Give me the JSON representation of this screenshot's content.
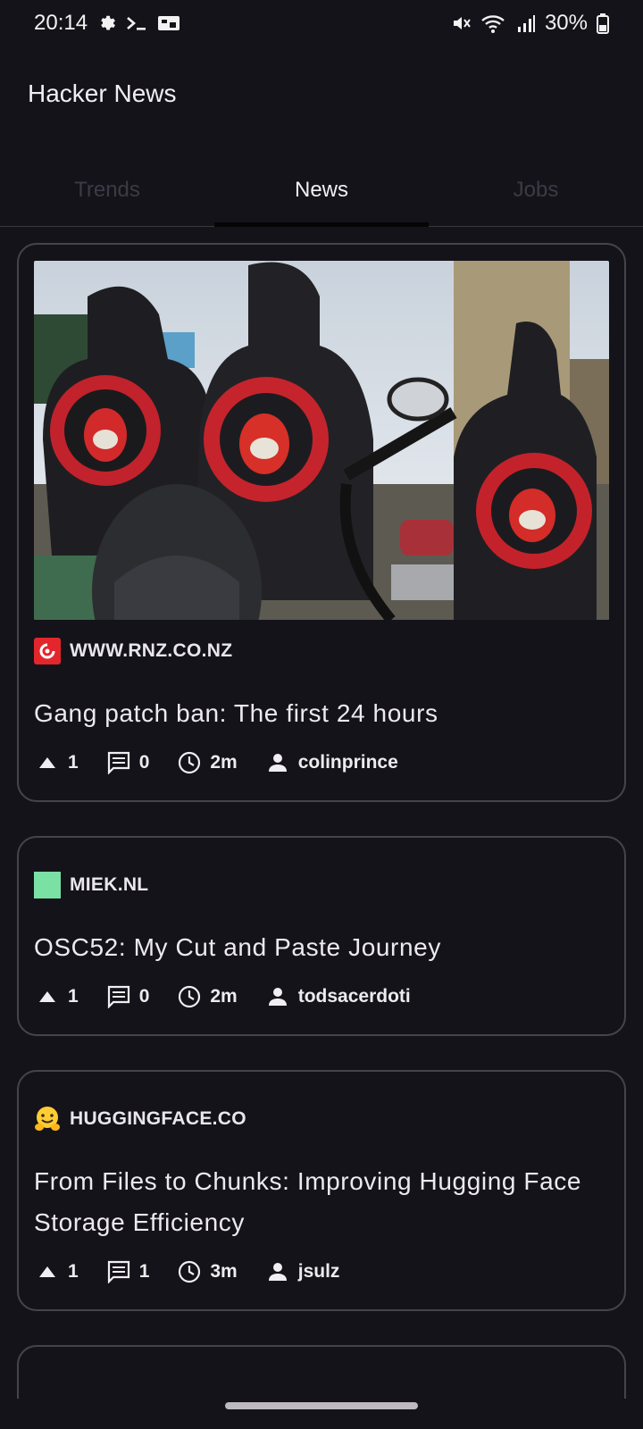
{
  "status_bar": {
    "time": "20:14",
    "battery": "30%",
    "icons_left": [
      "gear-icon",
      "terminal-icon",
      "tag-icon"
    ],
    "icons_right": [
      "mute-icon",
      "wifi-icon",
      "signal-icon",
      "battery-icon"
    ]
  },
  "app": {
    "title": "Hacker News"
  },
  "tabs": [
    {
      "label": "Trends",
      "active": false
    },
    {
      "label": "News",
      "active": true
    },
    {
      "label": "Jobs",
      "active": false
    }
  ],
  "stories": [
    {
      "source": "WWW.RNZ.CO.NZ",
      "favicon": "rnz-logo",
      "favicon_color": "#e3262c",
      "has_image": true,
      "title": "Gang patch ban: The first 24 hours",
      "points": "1",
      "comments": "0",
      "age": "2m",
      "author": "colinprince"
    },
    {
      "source": "MIEK.NL",
      "favicon": "green-square",
      "favicon_color": "#7be0a4",
      "has_image": false,
      "title": "OSC52: My Cut and Paste Journey",
      "points": "1",
      "comments": "0",
      "age": "2m",
      "author": "todsacerdoti"
    },
    {
      "source": "HUGGINGFACE.CO",
      "favicon": "hugging-face-emoji",
      "favicon_color": "#ffcc33",
      "has_image": false,
      "title": "From Files to Chunks: Improving Hugging Face Storage Efficiency",
      "points": "1",
      "comments": "1",
      "age": "3m",
      "author": "jsulz"
    }
  ]
}
